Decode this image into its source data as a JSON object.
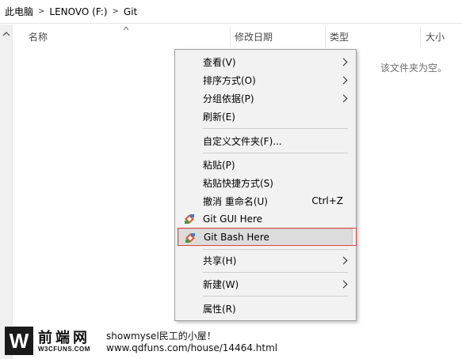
{
  "breadcrumb": {
    "items": [
      "此电脑",
      "LENOVO (F:)",
      "Git"
    ],
    "separator": ">"
  },
  "columns": {
    "name": "名称",
    "date": "修改日期",
    "type": "类型",
    "size": "大小"
  },
  "empty_message": "该文件夹为空。",
  "context_menu": {
    "items": [
      {
        "label": "查看(V)",
        "submenu": true
      },
      {
        "label": "排序方式(O)",
        "submenu": true
      },
      {
        "label": "分组依据(P)",
        "submenu": true
      },
      {
        "label": "刷新(E)"
      },
      {
        "label": "自定义文件夹(F)..."
      },
      {
        "label": "粘贴(P)"
      },
      {
        "label": "粘贴快捷方式(S)"
      },
      {
        "label": "撤消 重命名(U)",
        "shortcut": "Ctrl+Z"
      },
      {
        "label": "Git GUI Here",
        "icon": "git-icon"
      },
      {
        "label": "Git Bash Here",
        "icon": "git-icon",
        "highlighted": true
      },
      {
        "label": "共享(H)",
        "submenu": true
      },
      {
        "label": "新建(W)",
        "submenu": true
      },
      {
        "label": "属性(R)"
      }
    ]
  },
  "watermark": {
    "logo_letter": "W",
    "logo_cn": "前端网",
    "logo_en": "W3CFUNS.COM",
    "line1": "showmysel民工的小屋！",
    "line2": "www.qdfuns.com/house/14464.html"
  },
  "colors": {
    "highlight_border": "#e0423a",
    "menu_bg": "#f2f2f2"
  }
}
